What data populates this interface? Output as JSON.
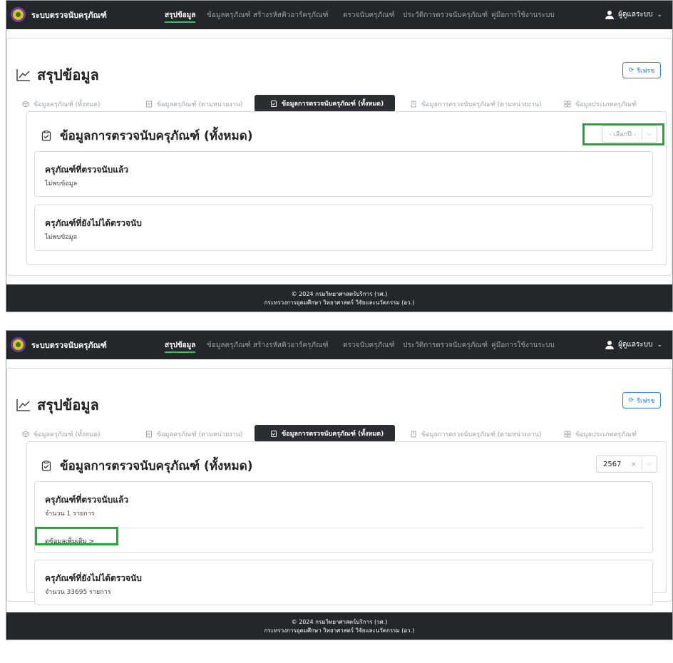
{
  "app": {
    "brand": "ระบบตรวจนับครุภัณฑ์",
    "nav": [
      "สรุปข้อมูล",
      "ข้อมูลครุภัณฑ์",
      "สร้างรหัสคิวอาร์ครุภัณฑ์",
      "ตรวจนับครุภัณฑ์",
      "ประวัติการตรวจนับครุภัณฑ์",
      "คู่มือการใช้งานระบบ"
    ],
    "user": "ผู้ดูแลระบบ"
  },
  "page": {
    "title": "สรุปข้อมูล",
    "refresh_label": "รีเฟรช",
    "tabs": [
      "ข้อมูลครุภัณฑ์ (ทั้งหมด)",
      "ข้อมูลครุภัณฑ์ (ตามหน่วยงาน)",
      "ข้อมูลการตรวจนับครุภัณฑ์ (ทั้งหมด)",
      "ข้อมูลการตรวจนับครุภัณฑ์ (ตามหน่วยงาน)",
      "ข้อมูลประเภทครุภัณฑ์"
    ],
    "panel_title": "ข้อมูลการตรวจนับครุภัณฑ์ (ทั้งหมด)",
    "year_placeholder": "- เลือกปี -",
    "year_value": "2567",
    "clear_symbol": "×",
    "counted_title": "ครุภัณฑ์ที่ตรวจนับแล้ว",
    "uncounted_title": "ครุภัณฑ์ที่ยังไม่ได้ตรวจนับ",
    "no_data": "ไม่พบข้อมูล",
    "counted_count": "จำนวน 1 รายการ",
    "uncounted_count": "จำนวน 33695 รายการ",
    "more_link": "ดูข้อมูลเพิ่มเติม >"
  },
  "footer": {
    "line1": "© 2024 กรมวิทยาศาสตร์บริการ (วศ.)",
    "line2": "กระทรวงการอุดมศึกษา วิทยาศาสตร์ วิจัยและนวัตกรรม (อว.)"
  },
  "colors": {
    "navbar": "#23272b",
    "active_underline": "#35c35a",
    "highlight": "#22a836",
    "link_blue": "#2f80ed"
  }
}
